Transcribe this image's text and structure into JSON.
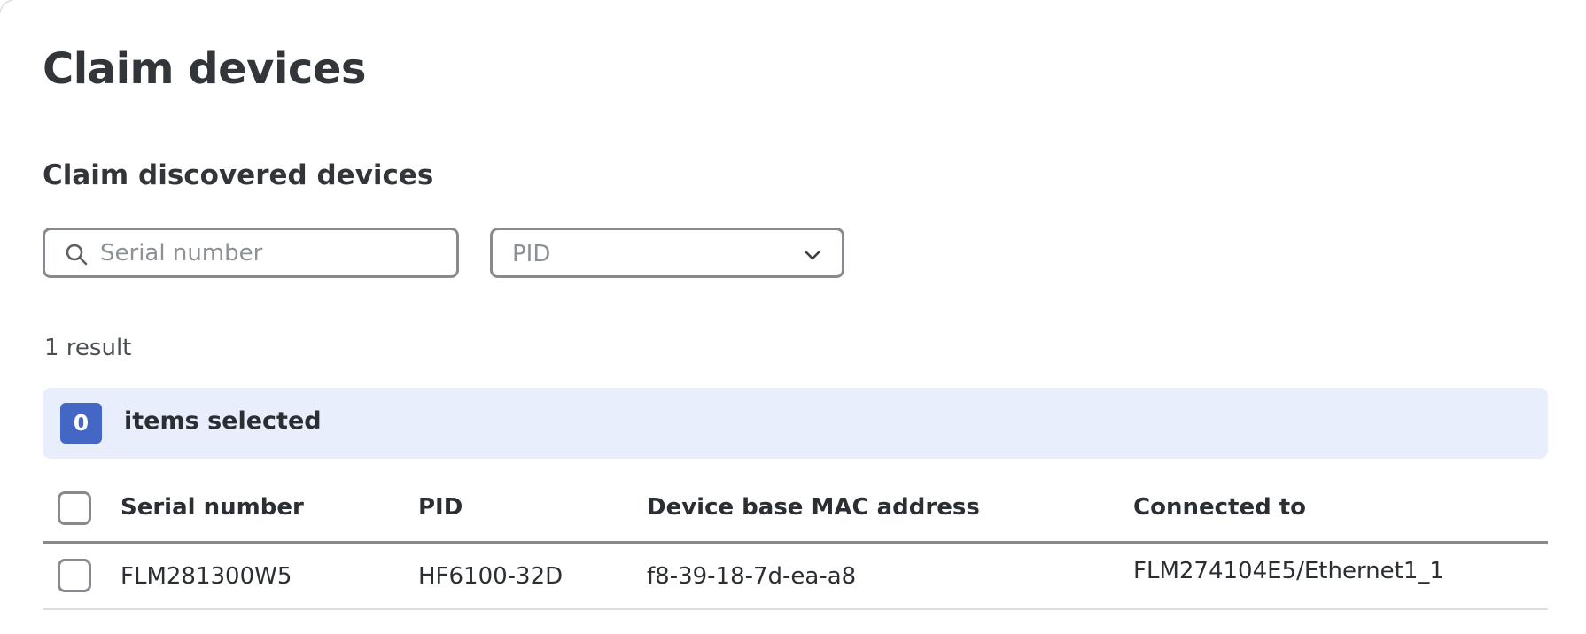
{
  "page": {
    "title": "Claim devices",
    "section_title": "Claim discovered devices"
  },
  "filters": {
    "search_placeholder": "Serial number",
    "search_value": "",
    "pid_placeholder": "PID"
  },
  "results": {
    "count_text": "1 result"
  },
  "selection": {
    "count": "0",
    "label": "items selected"
  },
  "table": {
    "headers": {
      "serial": "Serial number",
      "pid": "PID",
      "mac": "Device base MAC address",
      "connected": "Connected to"
    },
    "rows": [
      {
        "serial": "FLM281300W5",
        "pid": "HF6100-32D",
        "mac": "f8-39-18-7d-ea-a8",
        "connected": "FLM274104E5/Ethernet1_1",
        "selected": false
      }
    ]
  },
  "colors": {
    "accent": "#4466c5",
    "selection_bar_bg": "#e8eefc",
    "border": "#878b90"
  },
  "icons": {
    "search": "search-icon",
    "dropdown": "chevron-down-icon"
  }
}
